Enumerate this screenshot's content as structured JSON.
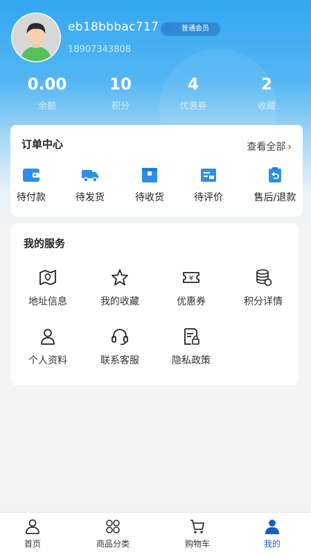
{
  "profile": {
    "username": "eb18bbbac717",
    "member_level": "普通会员",
    "phone": "18907343808"
  },
  "stats": [
    {
      "value": "0.00",
      "label": "余额"
    },
    {
      "value": "10",
      "label": "积分"
    },
    {
      "value": "4",
      "label": "优惠券"
    },
    {
      "value": "2",
      "label": "收藏"
    }
  ],
  "orders": {
    "title": "订单中心",
    "view_all": "查看全部",
    "items": [
      {
        "label": "待付款",
        "icon": "wallet-icon"
      },
      {
        "label": "待发货",
        "icon": "truck-icon"
      },
      {
        "label": "待收货",
        "icon": "box-icon"
      },
      {
        "label": "待评价",
        "icon": "review-icon"
      },
      {
        "label": "售后/退款",
        "icon": "refund-icon"
      }
    ]
  },
  "services": {
    "title": "我的服务",
    "items": [
      {
        "label": "地址信息",
        "icon": "map-icon"
      },
      {
        "label": "我的收藏",
        "icon": "star-icon"
      },
      {
        "label": "优惠券",
        "icon": "coupon-icon"
      },
      {
        "label": "积分详情",
        "icon": "coins-icon"
      },
      {
        "label": "个人资料",
        "icon": "user-icon"
      },
      {
        "label": "联系客服",
        "icon": "headset-icon"
      },
      {
        "label": "隐私政策",
        "icon": "policy-icon"
      }
    ]
  },
  "tabbar": {
    "items": [
      {
        "label": "首页",
        "icon": "home-user-icon"
      },
      {
        "label": "商品分类",
        "icon": "category-icon"
      },
      {
        "label": "购物车",
        "icon": "cart-icon"
      },
      {
        "label": "我的",
        "icon": "profile-icon"
      }
    ],
    "active": "我的"
  },
  "colors": {
    "header_blue": "#33a7f1",
    "accent": "#1a5fbf",
    "order_icon": "#2e8fe6"
  }
}
